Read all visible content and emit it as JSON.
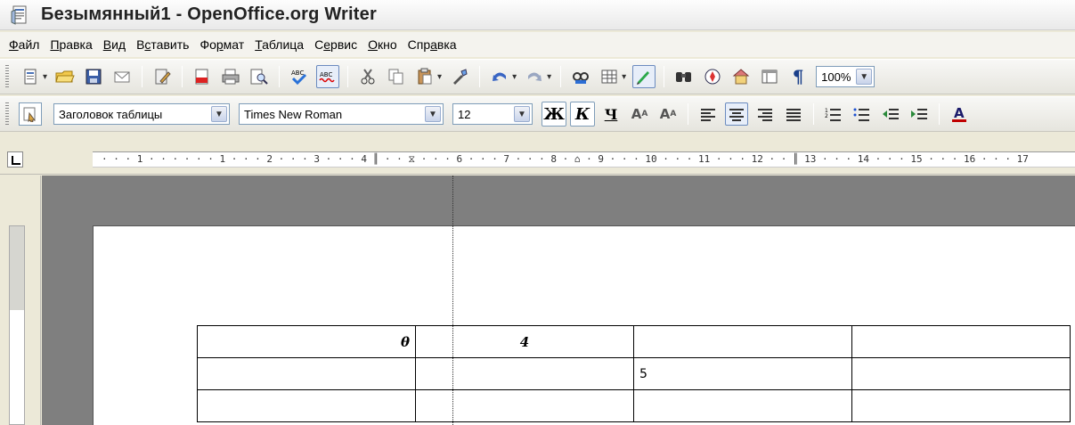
{
  "window": {
    "title": "Безымянный1 - OpenOffice.org Writer"
  },
  "menu": {
    "items": [
      {
        "pre": "",
        "u": "Ф",
        "post": "айл"
      },
      {
        "pre": "",
        "u": "П",
        "post": "равка"
      },
      {
        "pre": "",
        "u": "В",
        "post": "ид"
      },
      {
        "pre": "В",
        "u": "с",
        "post": "тавить"
      },
      {
        "pre": "Фо",
        "u": "р",
        "post": "мат"
      },
      {
        "pre": "",
        "u": "Т",
        "post": "аблица"
      },
      {
        "pre": "С",
        "u": "е",
        "post": "рвис"
      },
      {
        "pre": "",
        "u": "О",
        "post": "кно"
      },
      {
        "pre": "Спр",
        "u": "а",
        "post": "вка"
      }
    ]
  },
  "format_bar": {
    "style": "Заголовок таблицы",
    "font": "Times New Roman",
    "size": "12",
    "bold_label": "Ж",
    "italic_label": "К",
    "underline_label": "Ч"
  },
  "standard_bar": {
    "zoom": "100%"
  },
  "ruler": {
    "text": "· · · 1 · · ·   · · · 1 · · · 2 · · · 3 · · · 4 ║ · · ⧖ · · · 6 · · · 7 · · · 8 · ⌂ · 9 · · · 10 · · · 11 · · · 12 · · ║ 13 · · · 14 · · · 15 · · · 16 · · · 17"
  },
  "document": {
    "table": [
      [
        "θ",
        "4",
        "",
        ""
      ],
      [
        "",
        "",
        "5",
        ""
      ],
      [
        "",
        "",
        "",
        ""
      ]
    ]
  },
  "colors": {
    "accent": "#316ac5",
    "font_color_bar": "#c00000"
  }
}
